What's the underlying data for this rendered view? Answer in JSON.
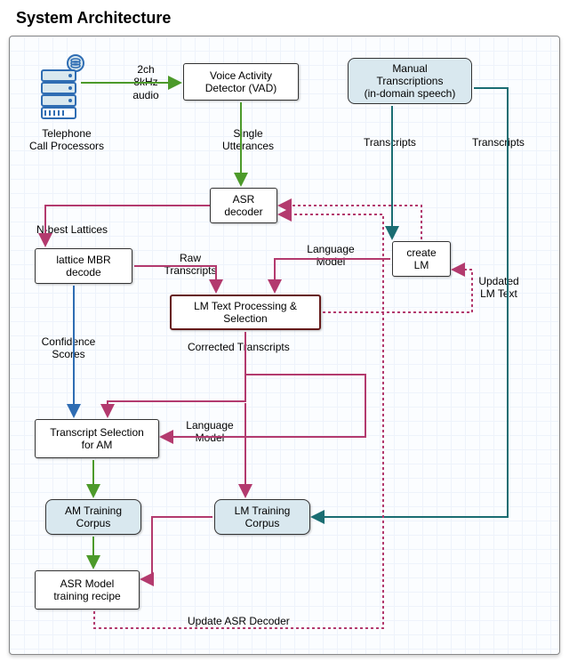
{
  "title": "System Architecture",
  "nodes": {
    "server_caption": "Telephone\nCall Processors",
    "vad": "Voice Activity\nDetector (VAD)",
    "manual": "Manual\nTranscriptions\n(in-domain speech)",
    "asr_decoder": "ASR\ndecoder",
    "create_lm": "create\nLM",
    "lattice_mbr": "lattice MBR\ndecode",
    "lm_text_proc": "LM Text Processing &\nSelection",
    "transcript_sel": "Transcript Selection\nfor AM",
    "am_corpus": "AM Training\nCorpus",
    "lm_corpus": "LM Training\nCorpus",
    "asr_recipe": "ASR Model\ntraining recipe"
  },
  "labels": {
    "audio_in": "2ch\n8kHz\naudio",
    "single_utt": "Single\nUtterances",
    "transcripts1": "Transcripts",
    "transcripts2": "Transcripts",
    "nbest": "N-best Lattices",
    "raw_trans": "Raw\nTranscripts",
    "lang_model1": "Language\nModel",
    "updated_lm": "Updated\nLM Text",
    "conf_scores": "Confidence\nScores",
    "corrected": "Corrected Transcripts",
    "lang_model2": "Language\nModel",
    "update_asr": "Update ASR Decoder"
  },
  "colors": {
    "green": "#4c9a2a",
    "pink": "#b33a6e",
    "teal": "#1a6d72",
    "blue": "#2f6db3"
  }
}
